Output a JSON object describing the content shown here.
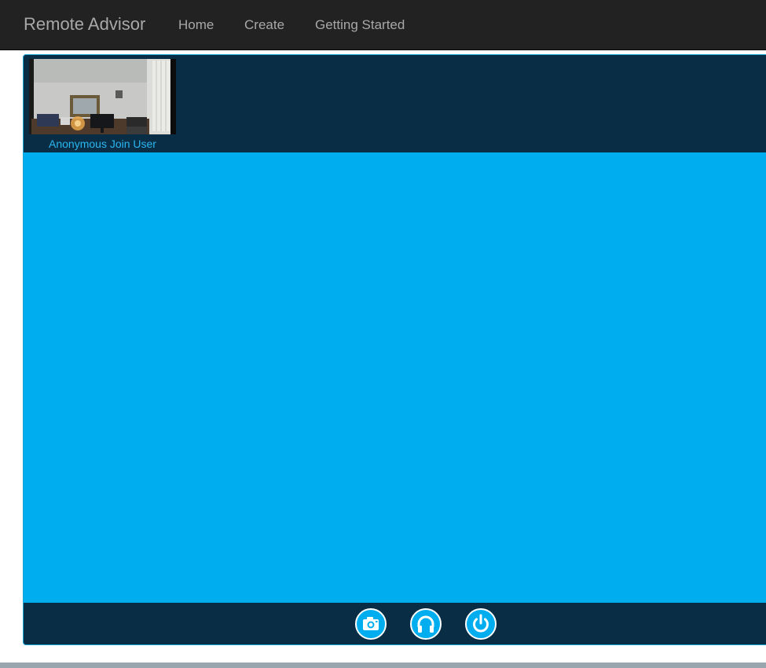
{
  "navbar": {
    "brand": "Remote Advisor",
    "links": [
      "Home",
      "Create",
      "Getting Started"
    ]
  },
  "session": {
    "participants": [
      {
        "name": "Anonymous Join User",
        "video_description": "office webcam view"
      }
    ]
  },
  "controls": [
    {
      "name": "camera",
      "icon": "camera-icon"
    },
    {
      "name": "audio",
      "icon": "headphones-icon"
    },
    {
      "name": "end-call",
      "icon": "power-icon"
    }
  ],
  "colors": {
    "navbar_bg": "#222222",
    "nav_text": "#a8a8a8",
    "panel_dark": "#0a2d46",
    "stage_blue": "#00aeef",
    "participant_label": "#2ab6f0"
  }
}
